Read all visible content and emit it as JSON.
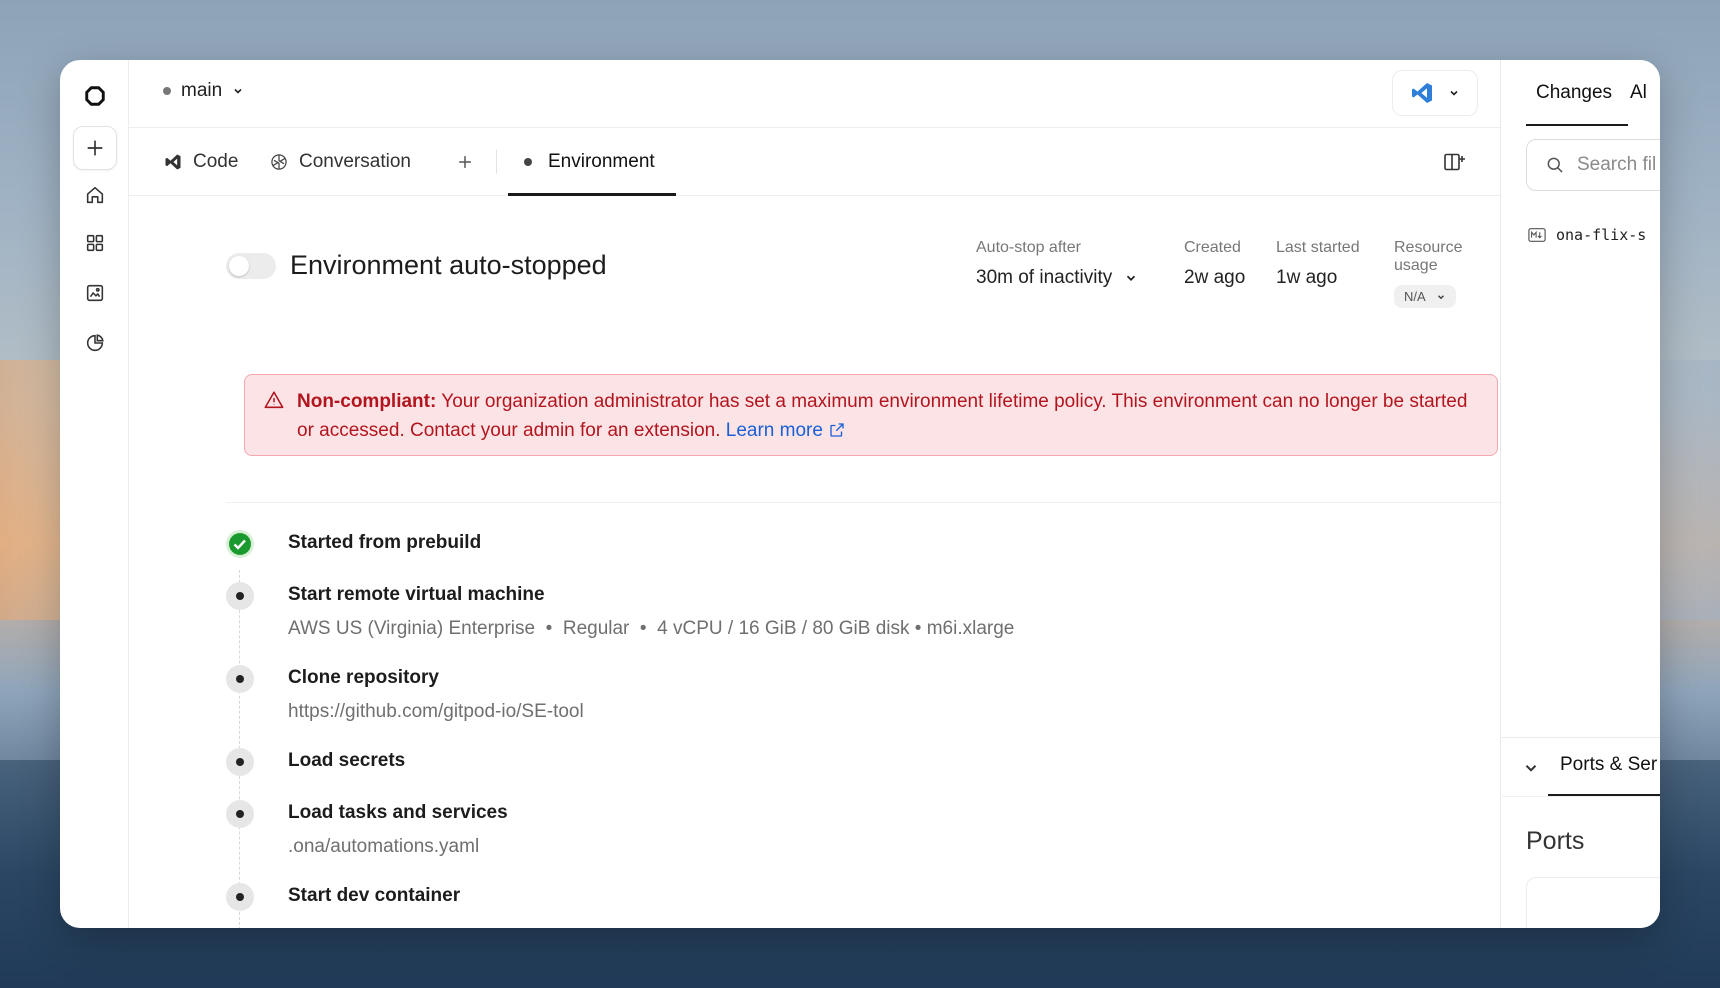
{
  "branch": {
    "name": "main"
  },
  "tabs": [
    {
      "label": "Code"
    },
    {
      "label": "Conversation"
    },
    {
      "label": "Environment"
    }
  ],
  "environment": {
    "title": "Environment auto-stopped",
    "autostop_label": "Auto-stop after",
    "autostop_value": "30m of inactivity",
    "created_label": "Created",
    "created_value": "2w ago",
    "last_started_label": "Last started",
    "last_started_value": "1w ago",
    "resource_label": "Resource usage",
    "resource_value": "N/A"
  },
  "alert": {
    "strong": "Non-compliant:",
    "text": " Your organization administrator has set a maximum environment lifetime policy. This environment can no longer be started or accessed. Contact your admin for an extension. ",
    "link": "Learn more"
  },
  "steps": [
    {
      "title": "Started from prebuild",
      "sub": "",
      "status": "done"
    },
    {
      "title": "Start remote virtual machine",
      "sub": "AWS US (Virginia) Enterprise  •  Regular  •  4 vCPU / 16 GiB / 80 GiB disk • m6i.xlarge",
      "status": "pending"
    },
    {
      "title": "Clone repository",
      "sub": "https://github.com/gitpod-io/SE-tool",
      "status": "pending"
    },
    {
      "title": "Load secrets",
      "sub": "",
      "status": "pending"
    },
    {
      "title": "Load tasks and services",
      "sub": ".ona/automations.yaml",
      "status": "pending"
    },
    {
      "title": "Start dev container",
      "sub": "",
      "status": "pending"
    }
  ],
  "right_panel": {
    "tab_changes": "Changes",
    "tab_all": "Al",
    "search_placeholder": "Search fil",
    "file_name": "ona-flix-s",
    "ports_tab": "Ports & Ser",
    "ports_title": "Ports"
  },
  "colors": {
    "alert_bg": "#fce4e6",
    "alert_text": "#b3151f",
    "link": "#1a5fd6",
    "success": "#1a9a2e",
    "vscode": "#2f7fd8"
  }
}
